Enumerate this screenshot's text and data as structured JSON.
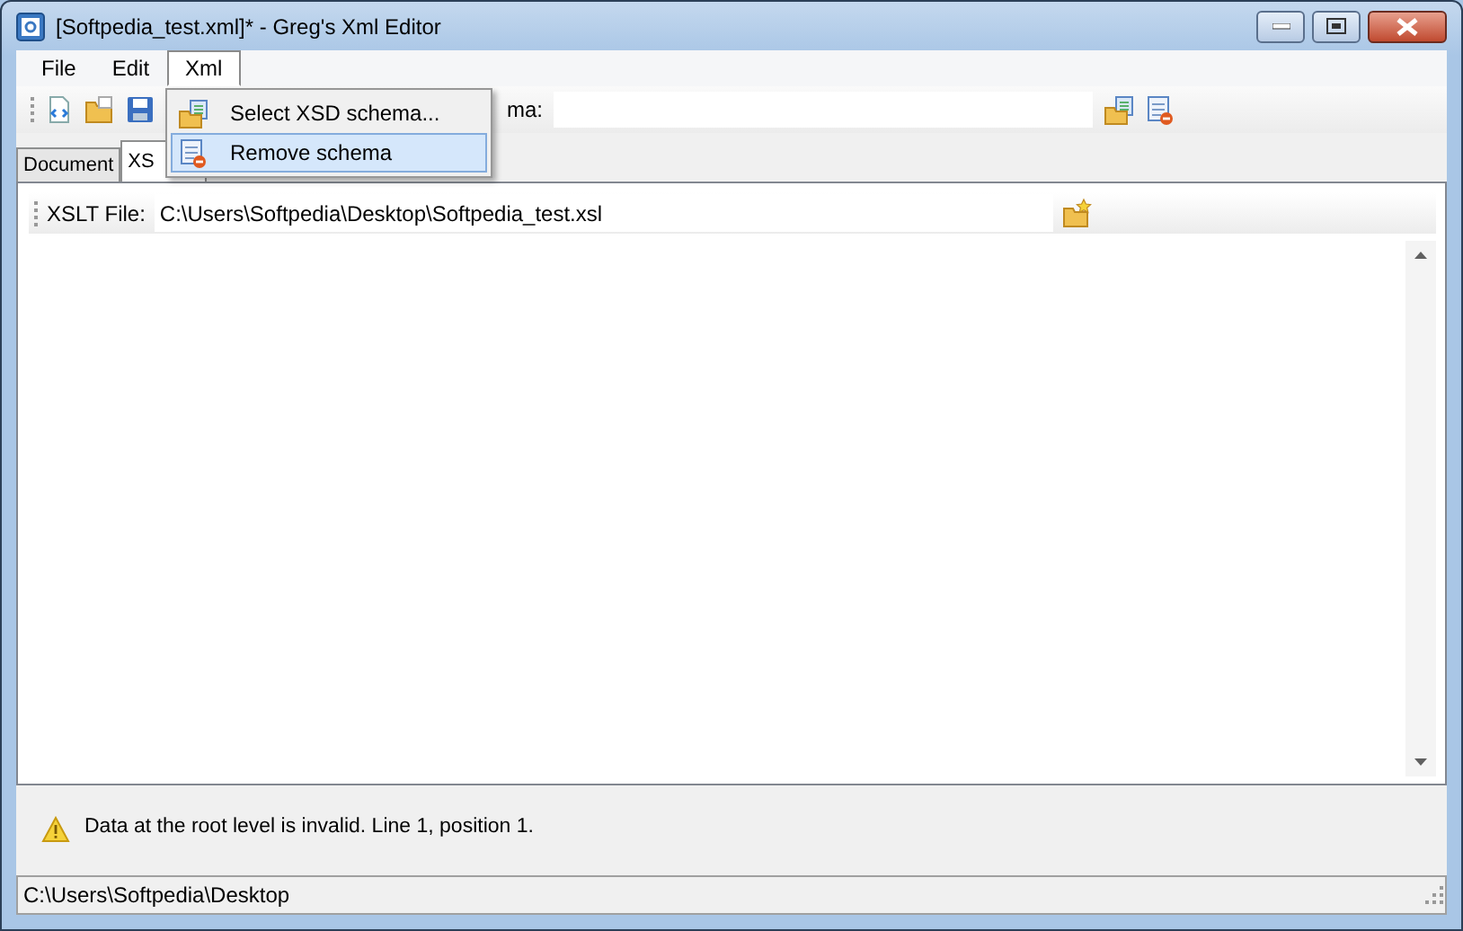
{
  "window": {
    "title": "[Softpedia_test.xml]* - Greg's Xml Editor"
  },
  "menu_bar": [
    {
      "label": "File",
      "selected": false
    },
    {
      "label": "Edit",
      "selected": false
    },
    {
      "label": "Xml",
      "selected": true
    }
  ],
  "xml_menu": [
    {
      "label": "Select XSD schema...",
      "selected": false
    },
    {
      "label": "Remove schema",
      "selected": true
    }
  ],
  "toolbar": {
    "schema_label": "ma:"
  },
  "tabs": [
    {
      "label": "Document",
      "selected": false
    },
    {
      "label": "XS",
      "selected": true
    }
  ],
  "xslt": {
    "label": "XSLT File:",
    "value": "C:\\Users\\Softpedia\\Desktop\\Softpedia_test.xsl"
  },
  "message": "Data at the root level is invalid. Line 1, position 1.",
  "status_bar": "C:\\Users\\Softpedia\\Desktop"
}
